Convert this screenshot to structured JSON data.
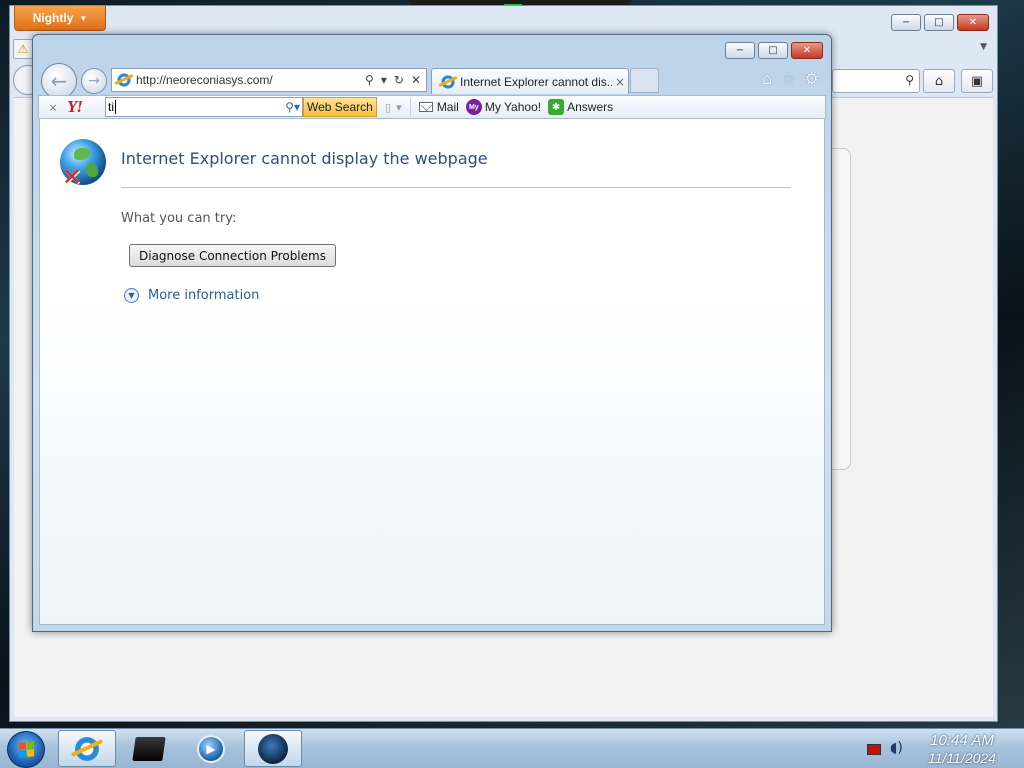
{
  "firefox": {
    "app_button_label": "Nightly",
    "window_buttons": {
      "minimize": "−",
      "maximize": "□",
      "close": "✕"
    }
  },
  "ie": {
    "window_buttons": {
      "minimize": "−",
      "maximize": "□",
      "close": "✕"
    },
    "address_bar": {
      "url": "http://neoreconiasys.com/"
    },
    "tab": {
      "title": "Internet Explorer cannot dis...",
      "close_glyph": "×"
    },
    "toolbar": {
      "close_glyph": "×",
      "yahoo_logo": "Y!",
      "search_value": "ti",
      "web_search_label": "Web Search",
      "links": [
        {
          "label": "Mail"
        },
        {
          "label": "My Yahoo!",
          "icon_text": "My"
        },
        {
          "label": "Answers"
        }
      ]
    },
    "content": {
      "error_title": "Internet Explorer cannot display the webpage",
      "what_you_can_try": "What you can try:",
      "diagnose_button": "Diagnose Connection Problems",
      "more_information": "More information"
    }
  },
  "taskbar": {
    "clock_time": "10:44 AM",
    "clock_date": "11/11/2024"
  },
  "colors": {
    "ie_title_blue": "#2e4f7a",
    "link_blue": "#2e5d93",
    "nightly_orange": "#e0701a",
    "close_red": "#c23a24",
    "yahoo_red": "#d51a1a"
  }
}
